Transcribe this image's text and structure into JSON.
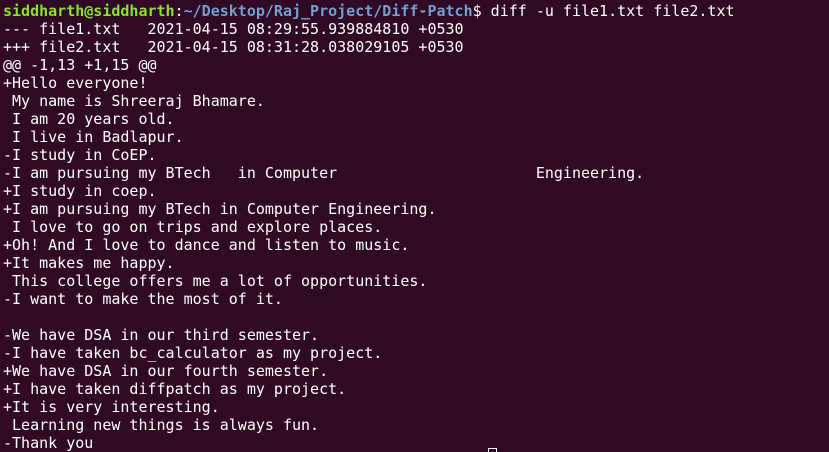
{
  "prompt": {
    "user_host": "siddharth@siddharth",
    "separator": ":",
    "path": "~/Desktop/Raj_Project/Diff-Patch",
    "symbol": "$ ",
    "command": "diff -u file1.txt file2.txt"
  },
  "output_lines": [
    "--- file1.txt   2021-04-15 08:29:55.939884810 +0530",
    "+++ file2.txt   2021-04-15 08:31:28.038029105 +0530",
    "@@ -1,13 +1,15 @@",
    "+Hello everyone!",
    " My name is Shreeraj Bhamare.",
    " I am 20 years old.",
    " I live in Badlapur.",
    "-I study in CoEP.",
    "-I am pursuing my BTech   in Computer                      Engineering.",
    "+I study in coep.",
    "+I am pursuing my BTech in Computer Engineering.",
    " I love to go on trips and explore places.",
    "+Oh! And I love to dance and listen to music.",
    "+It makes me happy.",
    " This college offers me a lot of opportunities.",
    "-I want to make the most of it.",
    "",
    "-We have DSA in our third semester.",
    "-I have taken bc_calculator as my project.",
    "+We have DSA in our fourth semester.",
    "+I have taken diffpatch as my project.",
    "+It is very interesting.",
    " Learning new things is always fun.",
    "-Thank you"
  ],
  "colors": {
    "background": "#300a24",
    "text": "#ffffff",
    "user_host": "#8ae234",
    "path": "#729fcf"
  }
}
